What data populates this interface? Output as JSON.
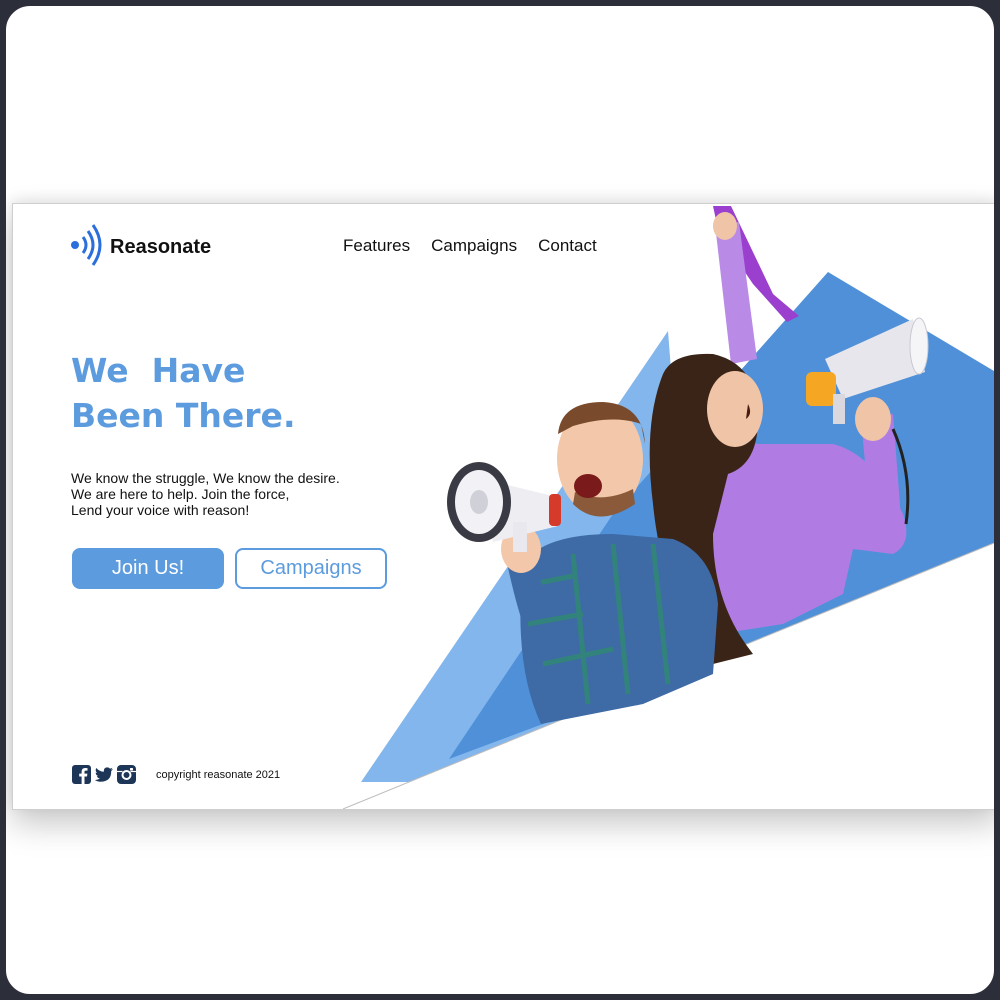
{
  "brand": {
    "name": "Reasonate",
    "accent_color": "#5b9bde"
  },
  "nav": {
    "items": [
      "Features",
      "Campaigns",
      "Contact"
    ]
  },
  "hero": {
    "headline_line1": "We  Have",
    "headline_line2": "Been There.",
    "body_line1": "We know the struggle, We know the desire.",
    "body_line2": "We are here to help. Join the force,",
    "body_line3": "Lend your voice with reason!",
    "primary_button": "Join Us!",
    "secondary_button": "Campaigns"
  },
  "footer": {
    "social_icons": [
      "facebook-icon",
      "twitter-icon",
      "instagram-icon"
    ],
    "copyright": "copyright reasonate 2021"
  }
}
